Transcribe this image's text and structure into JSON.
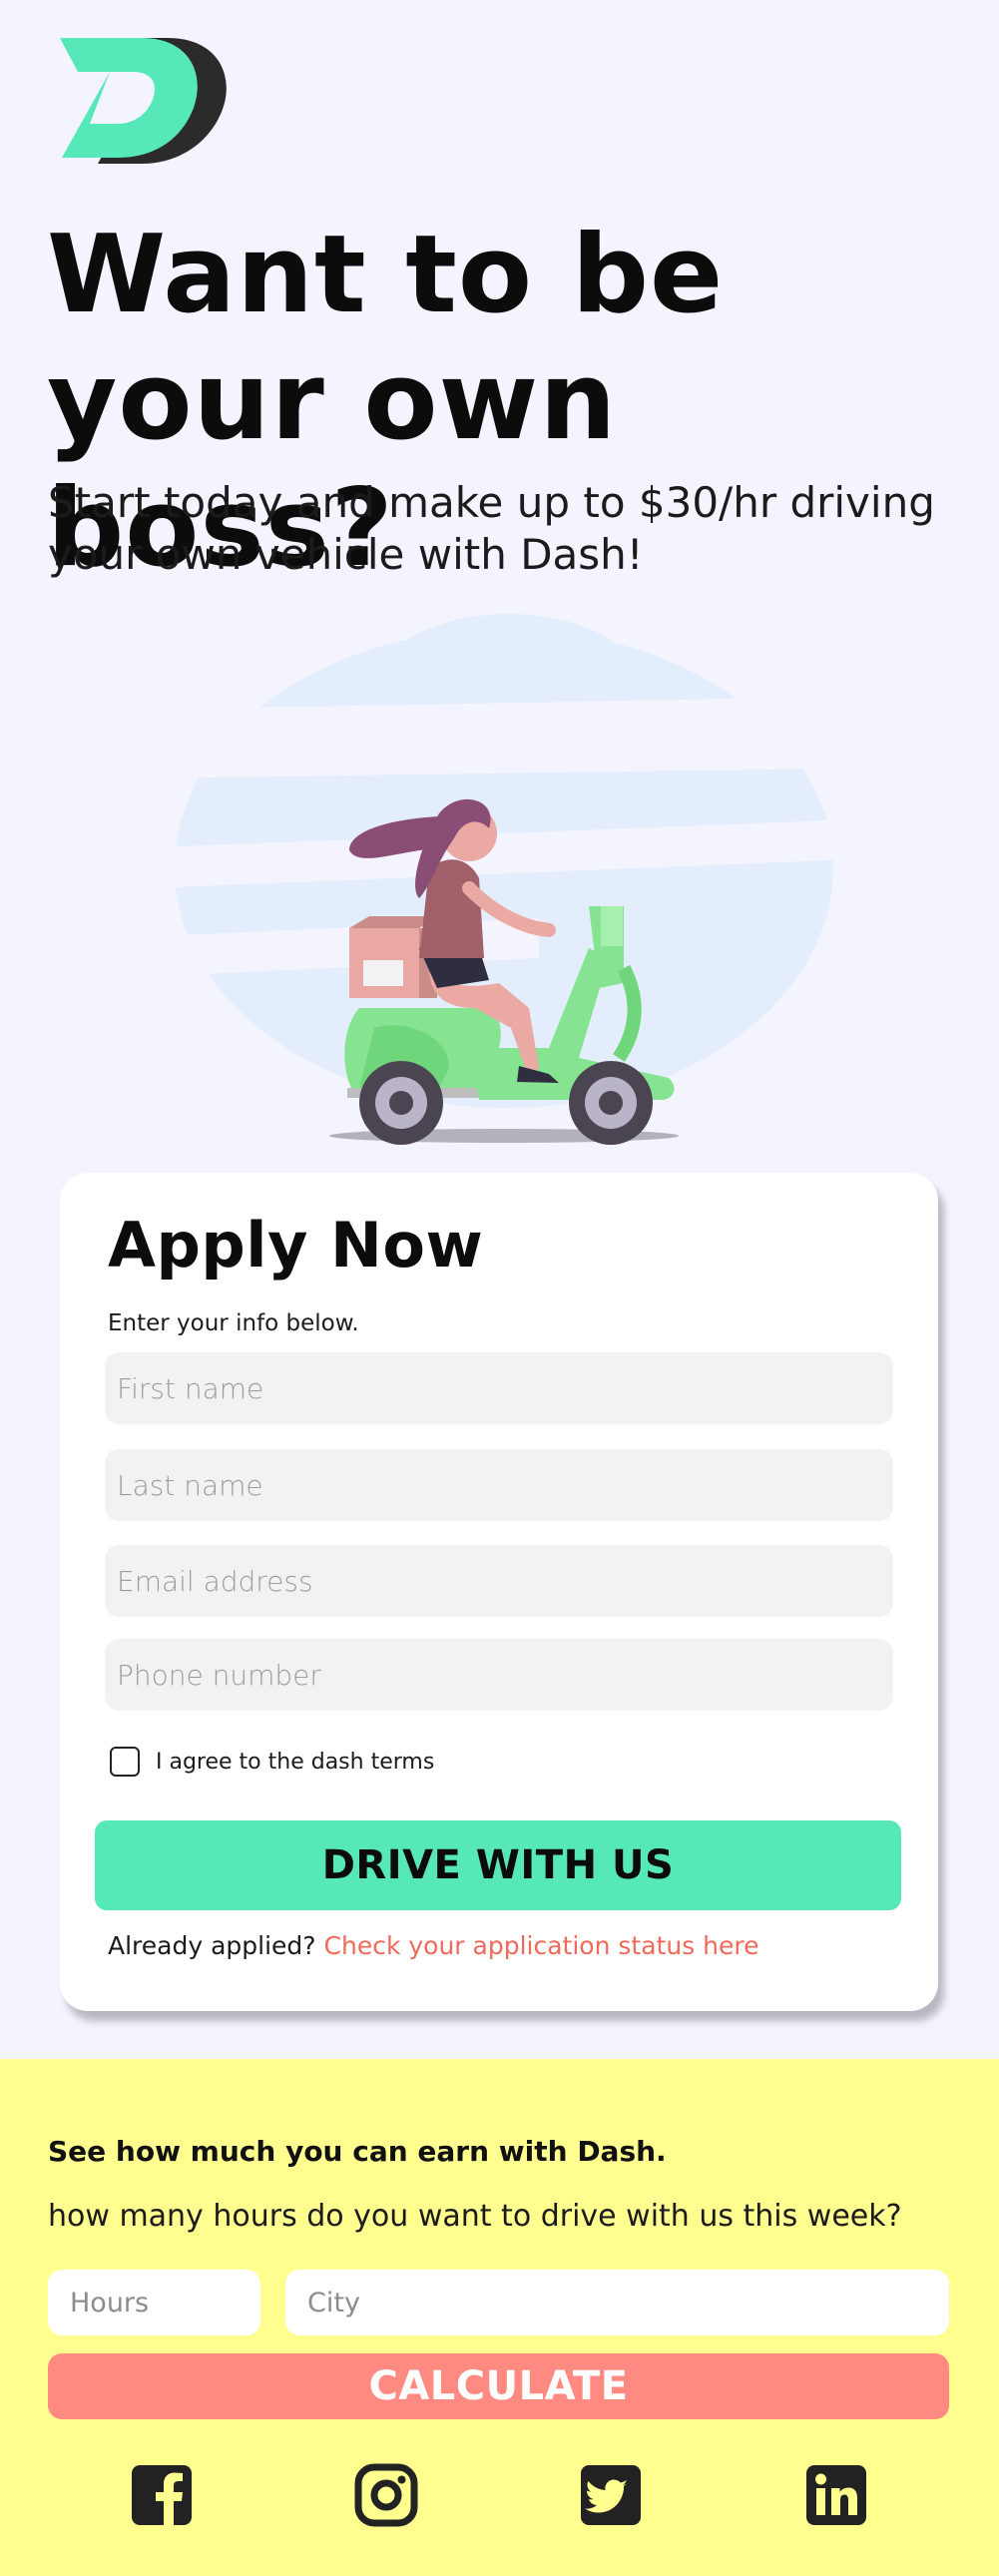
{
  "brand": {
    "logo_icon": "dash-d-logo-icon",
    "accent_green": "#56e8b9",
    "dark": "#2b2b2b"
  },
  "hero": {
    "headline": "Want to be your own boss?",
    "subheadline": "Start today and make up to $30/hr driving your own vehicle with Dash!",
    "illustration": "woman-riding-scooter-illustration"
  },
  "apply": {
    "title": "Apply Now",
    "instructions": "Enter your info below.",
    "fields": {
      "first_name": {
        "placeholder": "First name",
        "value": ""
      },
      "last_name": {
        "placeholder": "Last name",
        "value": ""
      },
      "email": {
        "placeholder": "Email address",
        "value": ""
      },
      "phone": {
        "placeholder": "Phone number",
        "value": ""
      }
    },
    "terms_label": "I agree to the dash terms",
    "terms_checked": false,
    "submit_label": "DRIVE WITH US",
    "already_applied_text": "Already applied?",
    "status_link_text": "Check your application status here",
    "link_color": "#f06a5b"
  },
  "earnings": {
    "title": "See how much you can earn with Dash.",
    "question": "how many hours do you want to drive with us this week?",
    "hours_placeholder": "Hours",
    "city_placeholder": "City",
    "calculate_label": "CALCULATE",
    "background": "#fffe8e",
    "button_color": "#ff8a82"
  },
  "social": [
    {
      "icon": "facebook-icon"
    },
    {
      "icon": "instagram-icon"
    },
    {
      "icon": "twitter-icon"
    },
    {
      "icon": "linkedin-icon"
    }
  ]
}
